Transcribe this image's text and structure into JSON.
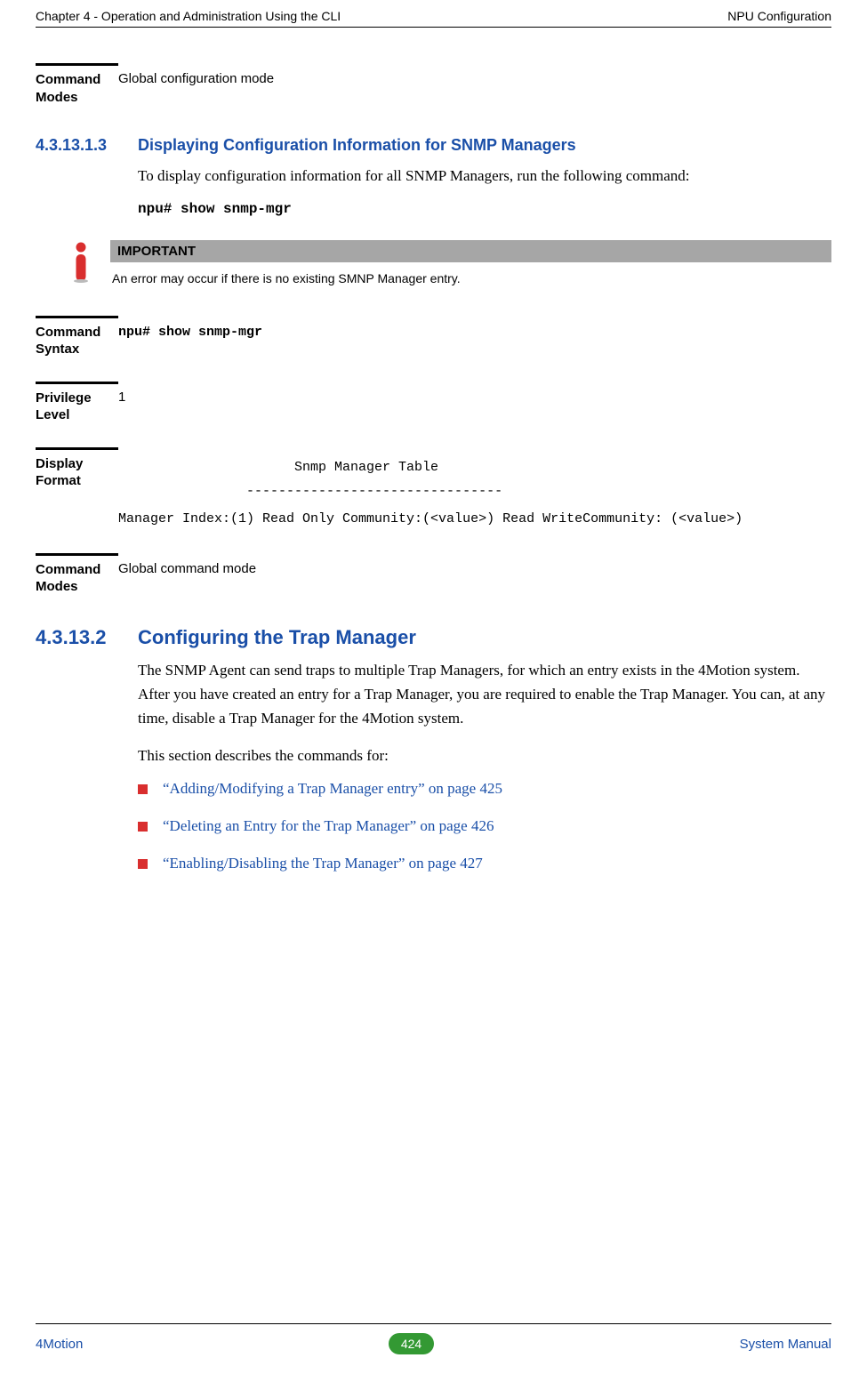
{
  "running_head": {
    "left": "Chapter 4 - Operation and Administration Using the CLI",
    "right": "NPU Configuration"
  },
  "block0": {
    "label": "Command Modes",
    "value": "Global configuration mode"
  },
  "sec1": {
    "num": "4.3.13.1.3",
    "title": "Displaying Configuration Information for SNMP Managers",
    "para": "To display configuration information for all SNMP Managers, run the following command:",
    "cmd": "npu# show snmp-mgr"
  },
  "callout": {
    "title": "IMPORTANT",
    "body": "An error may occur if there is no existing SMNP Manager entry."
  },
  "syntax": {
    "label": "Command Syntax",
    "value": "npu# show snmp-mgr"
  },
  "priv": {
    "label": "Privilege Level",
    "value": "1"
  },
  "disp": {
    "label": "Display Format",
    "line1": "                      Snmp Manager Table",
    "line2": "                --------------------------------",
    "line3": "Manager Index:(1) Read Only Community:(<value>) Read WriteCommunity: (<value>)"
  },
  "modes2": {
    "label": "Command Modes",
    "value": "Global command mode"
  },
  "sec2": {
    "num": "4.3.13.2",
    "title": "Configuring the Trap Manager",
    "para1": "The SNMP Agent can send traps to multiple Trap Managers, for which an entry exists in the 4Motion system. After you have created an entry for a Trap Manager, you are required to enable the Trap Manager. You can, at any time, disable a Trap Manager for the 4Motion system.",
    "para2": "This section describes the commands for:",
    "bullets": [
      "“Adding/Modifying a Trap Manager entry” on page 425",
      "“Deleting an Entry for the Trap Manager” on page 426",
      "“Enabling/Disabling the Trap Manager” on page 427"
    ]
  },
  "footer": {
    "left": "4Motion",
    "page": "424",
    "right": "System Manual"
  }
}
